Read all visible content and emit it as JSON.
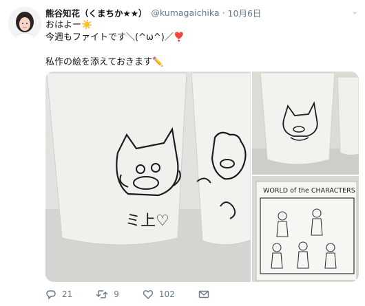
{
  "tweet": {
    "author_name": "熊谷知花（くまちか★★）",
    "handle": "@kumagaichika",
    "separator": "·",
    "date": "10月6日",
    "caret": "⌄",
    "text": "おはよー☀️\n今週もファイトです＼(^ω^)／❣️\n\n私作の絵を添えておきます✏️"
  },
  "media": {
    "panels": [
      "cups-photo",
      "cat-cup-photo",
      "characters-sketch-photo"
    ],
    "sketch_title": "WORLD of the CHARACTERS",
    "cup_writing": "ミ上♡"
  },
  "actions": {
    "replies": "21",
    "retweets": "9",
    "likes": "102"
  },
  "colors": {
    "name": "#14171a",
    "muted": "#657786",
    "icon": "#657786"
  }
}
